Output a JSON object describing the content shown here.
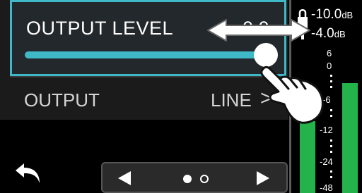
{
  "output_level": {
    "title": "OUTPUT LEVEL",
    "value": "0.0",
    "unit": "dB",
    "slider_fraction": 1.0
  },
  "output": {
    "label": "OUTPUT",
    "value": "LINE",
    "chevron": ">"
  },
  "meter": {
    "peak_top": {
      "value": "-10.0",
      "unit": "dB"
    },
    "peak_bottom": {
      "value": "-4.0",
      "unit": "dB"
    },
    "scale": [
      "6",
      "0",
      "-6",
      "-12",
      "-24",
      "-48"
    ],
    "bar_color": "#23b34a"
  },
  "colors": {
    "accent": "#3fb8c8",
    "background": "#000000"
  },
  "icons": {
    "back": "back-arrow-icon",
    "prev": "triangle-left-icon",
    "next": "triangle-right-icon",
    "arrow": "double-headed-arrow-icon",
    "hand": "pointing-hand-icon",
    "lock": "padlock-icon"
  },
  "pager": {
    "pages": 2,
    "current": 1
  }
}
